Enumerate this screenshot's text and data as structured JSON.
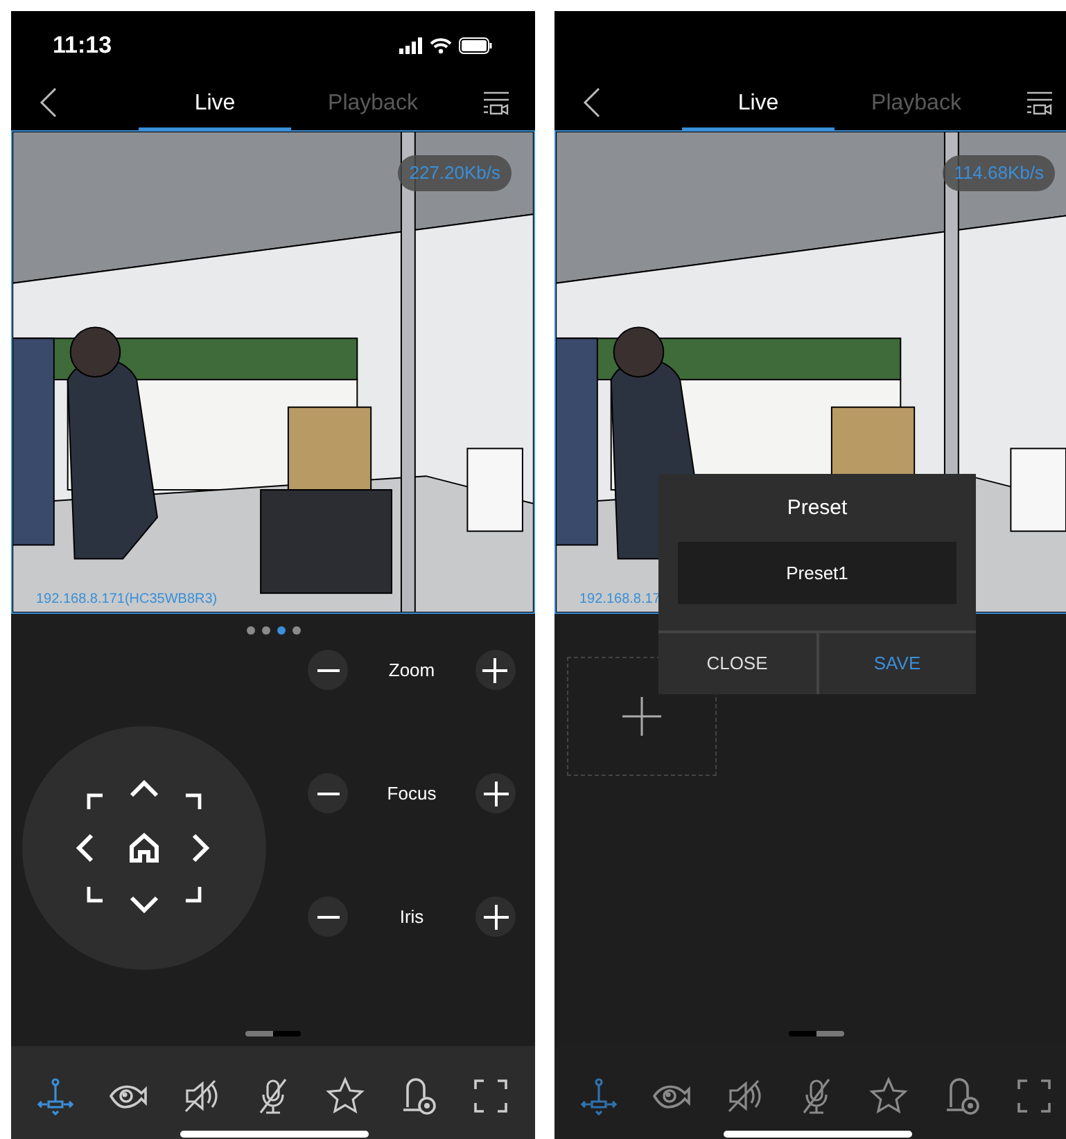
{
  "screens": [
    {
      "status_bar": {
        "time": "11:13"
      },
      "tabs": [
        {
          "label": "Live",
          "selected": true
        },
        {
          "label": "Playback",
          "selected": false
        }
      ],
      "video": {
        "bitrate": "227.20Kb/s",
        "device_label": "192.168.8.171(HC35WB8R3)"
      },
      "pager_dots": [
        {
          "selected": false
        },
        {
          "selected": false
        },
        {
          "selected": true
        },
        {
          "selected": false
        }
      ],
      "panel": {
        "kind": "ptz",
        "lens_controls": [
          {
            "label": "Zoom"
          },
          {
            "label": "Focus"
          },
          {
            "label": "Iris"
          }
        ]
      },
      "page_indicator": [
        {
          "selected": true
        },
        {
          "selected": false
        }
      ],
      "toolbar": [
        {
          "kind": "ptz",
          "selected": true
        },
        {
          "kind": "eye",
          "selected": false
        },
        {
          "kind": "sound-off",
          "selected": false
        },
        {
          "kind": "mic-off",
          "selected": false
        },
        {
          "kind": "star",
          "selected": false
        },
        {
          "kind": "preset",
          "selected": false
        },
        {
          "kind": "fullscreen",
          "selected": false
        }
      ]
    },
    {
      "tabs": [
        {
          "label": "Live",
          "selected": true
        },
        {
          "label": "Playback",
          "selected": false
        }
      ],
      "video": {
        "bitrate": "114.68Kb/s",
        "device_label": "192.168.8.17"
      },
      "panel": {
        "kind": "preset"
      },
      "dialog": {
        "title": "Preset",
        "value": "Preset1",
        "buttons": [
          {
            "label": "CLOSE",
            "kind": "cancel"
          },
          {
            "label": "SAVE",
            "kind": "confirm"
          }
        ]
      },
      "page_indicator": [
        {
          "selected": false
        },
        {
          "selected": true
        }
      ],
      "toolbar": [
        {
          "kind": "ptz",
          "selected": true
        },
        {
          "kind": "eye",
          "selected": false
        },
        {
          "kind": "sound-off",
          "selected": false
        },
        {
          "kind": "mic-off",
          "selected": false
        },
        {
          "kind": "star",
          "selected": false
        },
        {
          "kind": "preset",
          "selected": false
        },
        {
          "kind": "fullscreen",
          "selected": false
        }
      ]
    }
  ]
}
